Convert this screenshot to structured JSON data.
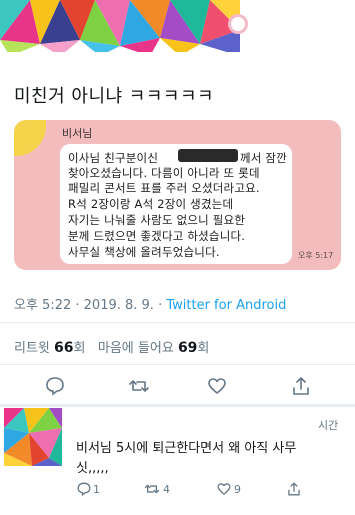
{
  "tweet": {
    "text": "미친거 아니냐 ㅋㅋㅋㅋㅋ",
    "time": "오후 5:22",
    "sep": " · ",
    "date": "2019. 8. 9.",
    "source": "Twitter for Android"
  },
  "message_image": {
    "sender": "비서님",
    "lines": [
      "이사님 친구분이신",
      "께서 잠깐",
      "찾아오셨습니다. 다름이 아니라 또 롯데",
      "패밀리 콘서트 표를 주러 오셨더라고요.",
      "R석 2장이랑 A석 2장이 생겼는데",
      "자기는 나눠줄 사람도 없으니 필요한",
      "분께 드렸으면 좋겠다고 하셨습니다.",
      "사무실 책상에 올려두었습니다."
    ],
    "time": "오후 5:17"
  },
  "stats": {
    "retweet_label": "리트윗",
    "retweet_count": "66",
    "retweet_unit": "회",
    "like_label": "마음에 들어요",
    "like_count": "69",
    "like_unit": "회"
  },
  "actions": [
    "reply-icon",
    "retweet-icon",
    "heart-icon",
    "share-icon"
  ],
  "reply": {
    "time": "시간",
    "line1": "비서님 5시에 퇴근한다면서 왜 아직 사무",
    "line2": "싯,,,,,",
    "reply_count": "1",
    "retweet_count": "4",
    "like_count": "9"
  },
  "colors": {
    "accent": "#1da1f2",
    "muted": "#657786",
    "message_bg": "#f4bdbd"
  }
}
